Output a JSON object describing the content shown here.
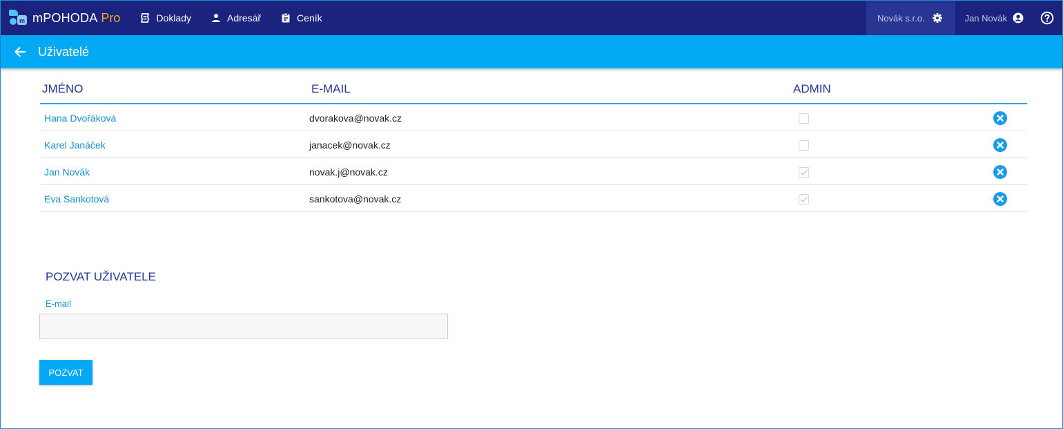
{
  "app": {
    "name": "mPOHODA",
    "edition": "Pro",
    "logo_mark": "m",
    "brand_color": "#1a237e",
    "accent_color": "#03a9f4",
    "pro_color": "#f5a623"
  },
  "nav": {
    "items": [
      {
        "label": "Doklady",
        "icon": "receipt-icon"
      },
      {
        "label": "Adresář",
        "icon": "person-icon"
      },
      {
        "label": "Ceník",
        "icon": "clipboard-icon"
      }
    ],
    "company": {
      "label": "Novák s.r.o.",
      "icon": "gear-icon"
    },
    "user": {
      "label": "Jan Novák",
      "icon": "account-circle-icon"
    },
    "help_icon": "help-icon"
  },
  "page": {
    "title": "Uživatelé",
    "back_icon": "arrow-left-icon"
  },
  "table": {
    "headers": {
      "name": "JMÉNO",
      "email": "E-MAIL",
      "admin": "ADMIN"
    },
    "rows": [
      {
        "name": "Hana Dvořáková",
        "email": "dvorakova@novak.cz",
        "admin": false
      },
      {
        "name": "Karel Janáček",
        "email": "janacek@novak.cz",
        "admin": false
      },
      {
        "name": "Jan Novák",
        "email": "novak.j@novak.cz",
        "admin": true
      },
      {
        "name": "Eva Sankotová",
        "email": "sankotova@novak.cz",
        "admin": true
      }
    ],
    "delete_icon": "close-circle-icon"
  },
  "invite": {
    "title": "POZVAT UŽIVATELE",
    "email_label": "E-mail",
    "email_value": "",
    "button_label": "POZVAT"
  }
}
